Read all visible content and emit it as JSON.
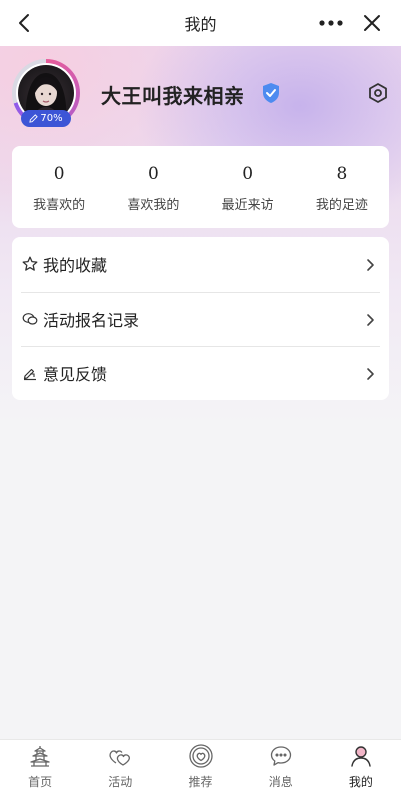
{
  "header": {
    "title": "我的",
    "back_icon": "chevron-left-icon",
    "more_icon": "more-dots-icon",
    "close_icon": "close-icon"
  },
  "profile": {
    "username": "大王叫我来相亲",
    "completion_text": "70%",
    "completion_fraction": 0.7,
    "verified_icon": "verified-shield-icon",
    "settings_icon": "settings-hexagon-icon",
    "ring_colors": [
      "#e85d9a",
      "#8f5bea"
    ],
    "badge_color": "#3c55d6"
  },
  "stats": [
    {
      "value": "0",
      "label": "我喜欢的"
    },
    {
      "value": "0",
      "label": "喜欢我的"
    },
    {
      "value": "0",
      "label": "最近来访"
    },
    {
      "value": "8",
      "label": "我的足迹"
    }
  ],
  "menu": [
    {
      "label": "我的收藏",
      "icon": "star-outline-icon"
    },
    {
      "label": "活动报名记录",
      "icon": "chat-bubbles-icon"
    },
    {
      "label": "意见反馈",
      "icon": "feedback-pen-icon"
    }
  ],
  "tabbar": {
    "items": [
      {
        "label": "首页",
        "icon": "pagoda-icon",
        "active": false
      },
      {
        "label": "活动",
        "icon": "hearts-icon",
        "active": false
      },
      {
        "label": "推荐",
        "icon": "heart-circle-icon",
        "active": false
      },
      {
        "label": "消息",
        "icon": "message-bubble-icon",
        "active": false
      },
      {
        "label": "我的",
        "icon": "person-icon",
        "active": true
      }
    ]
  }
}
